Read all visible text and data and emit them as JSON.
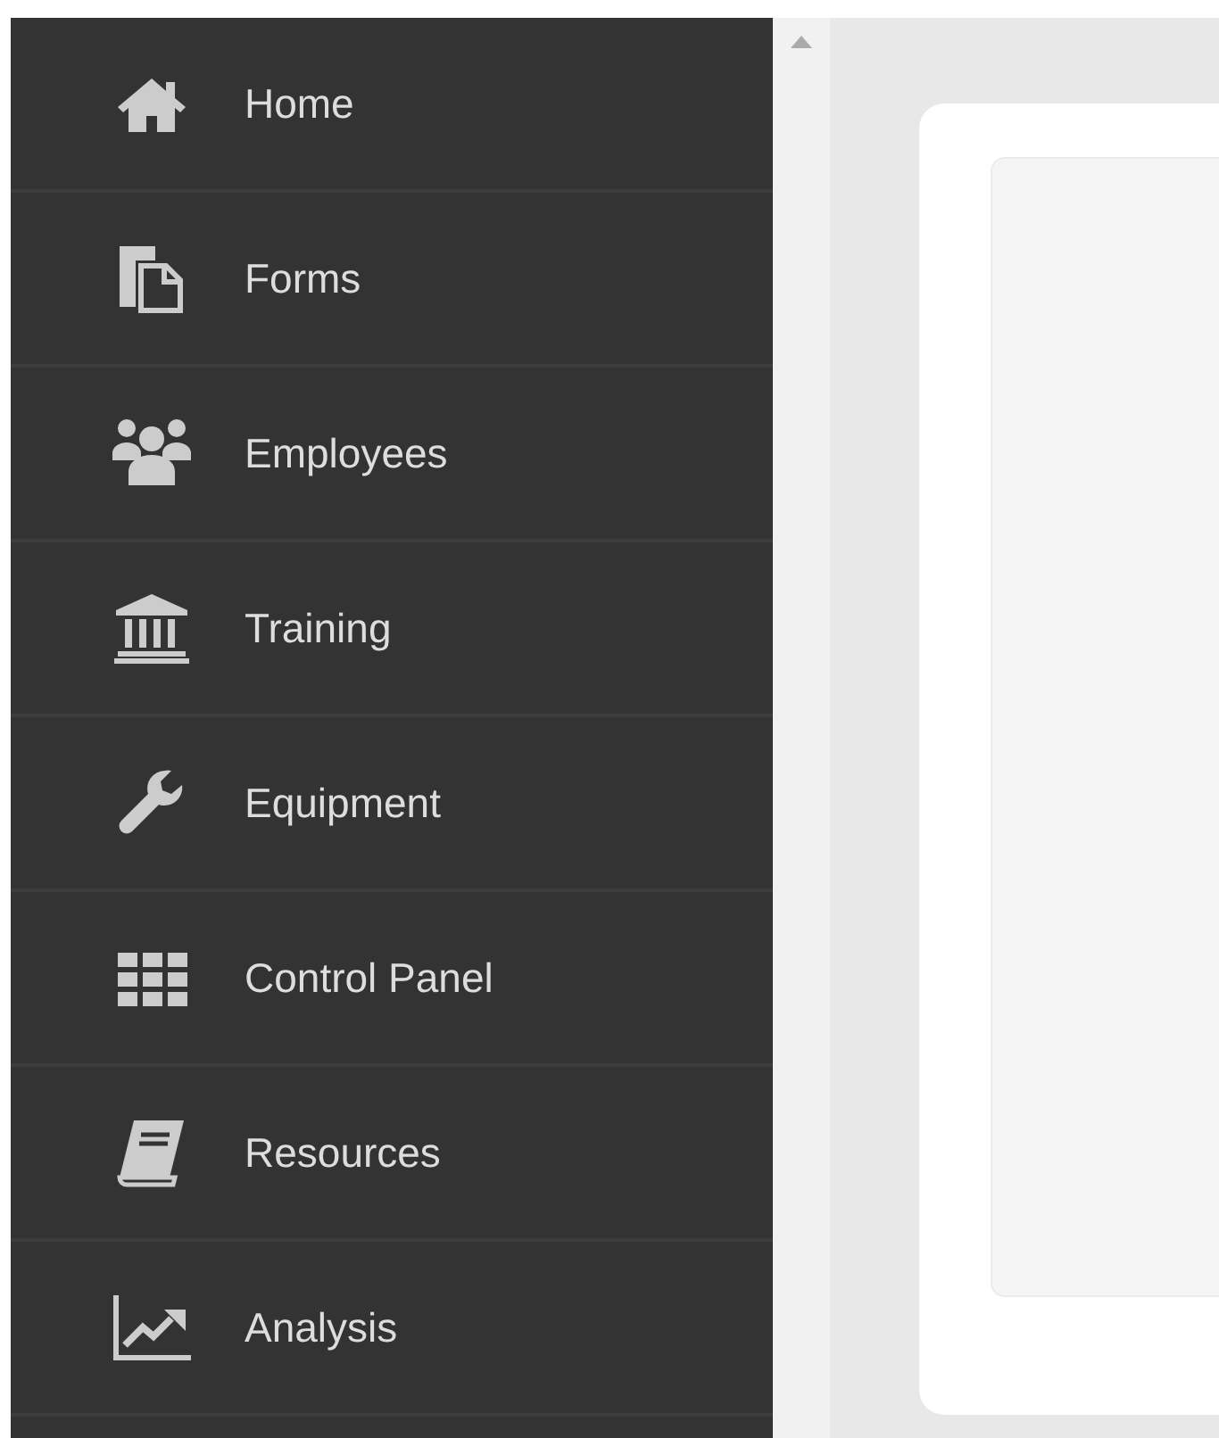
{
  "sidebar": {
    "items": [
      {
        "label": "Home"
      },
      {
        "label": "Forms"
      },
      {
        "label": "Employees"
      },
      {
        "label": "Training"
      },
      {
        "label": "Equipment"
      },
      {
        "label": "Control Panel"
      },
      {
        "label": "Resources"
      },
      {
        "label": "Analysis"
      }
    ]
  }
}
